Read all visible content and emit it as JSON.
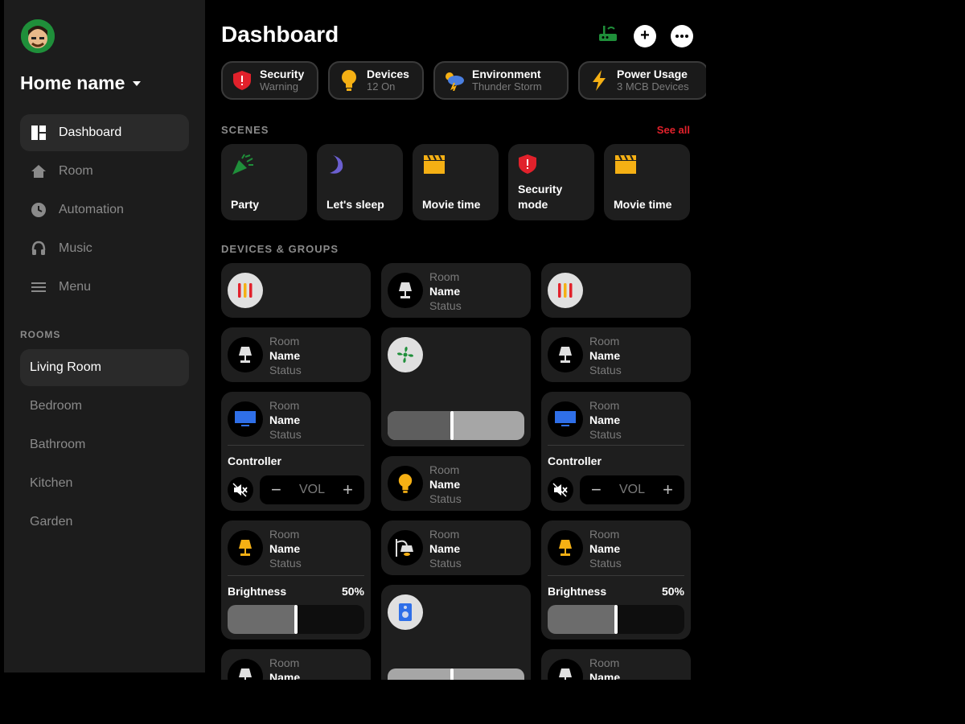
{
  "sidebar": {
    "home_name": "Home name",
    "nav": [
      {
        "label": "Dashboard",
        "icon": "dashboard-icon",
        "active": true
      },
      {
        "label": "Room",
        "icon": "home-icon",
        "active": false
      },
      {
        "label": "Automation",
        "icon": "clock-icon",
        "active": false
      },
      {
        "label": "Music",
        "icon": "headphones-icon",
        "active": false
      },
      {
        "label": "Menu",
        "icon": "menu-icon",
        "active": false
      }
    ],
    "rooms_title": "ROOMS",
    "rooms": [
      {
        "label": "Living Room",
        "active": true
      },
      {
        "label": "Bedroom",
        "active": false
      },
      {
        "label": "Bathroom",
        "active": false
      },
      {
        "label": "Kitchen",
        "active": false
      },
      {
        "label": "Garden",
        "active": false
      }
    ]
  },
  "header": {
    "title": "Dashboard",
    "actions": [
      "router-icon",
      "add-icon",
      "more-icon"
    ]
  },
  "status_chips": [
    {
      "title": "Security",
      "subtitle": "Warning",
      "icon": "shield-icon",
      "color": "#e1212b"
    },
    {
      "title": "Devices",
      "subtitle": "12 On",
      "icon": "bulb-icon",
      "color": "#f5b014"
    },
    {
      "title": "Environment",
      "subtitle": "Thunder Storm",
      "icon": "storm-icon",
      "color": "#4a7fe0"
    },
    {
      "title": "Power Usage",
      "subtitle": "3 MCB Devices",
      "icon": "bolt-icon",
      "color": "#f5b014"
    }
  ],
  "scenes": {
    "title": "SCENES",
    "see_all": "See all",
    "items": [
      {
        "label": "Party",
        "icon": "party-icon"
      },
      {
        "label": "Let's sleep",
        "icon": "moon-icon"
      },
      {
        "label": "Movie time",
        "icon": "clapper-icon"
      },
      {
        "label": "Security\nmode",
        "icon": "shield-icon"
      },
      {
        "label": "Movie time",
        "icon": "clapper-icon"
      }
    ]
  },
  "devices": {
    "title": "DEVICES & GROUPS",
    "room": "Room",
    "name": "Name",
    "status": "Status",
    "controller_label": "Controller",
    "vol_label": "VOL",
    "brightness_label": "Brightness",
    "brightness_value": "50%",
    "brightness_fraction": 0.5,
    "fan_slider_fraction": 0.47
  },
  "colors": {
    "accent_red": "#e1212b",
    "accent_yellow": "#f5b014",
    "accent_blue": "#2f6fe8",
    "accent_green": "#1f8f3a"
  }
}
